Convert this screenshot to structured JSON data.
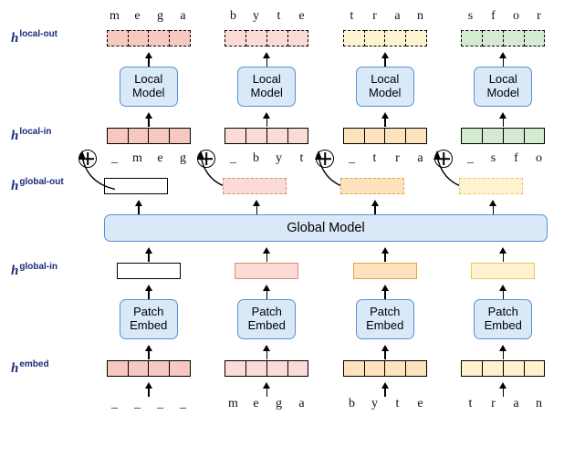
{
  "labels": {
    "local_out": "local-out",
    "local_in": "local-in",
    "global_out": "global-out",
    "global_in": "global-in",
    "embed": "embed",
    "h": "h"
  },
  "components": {
    "local_model": "Local Model",
    "global_model": "Global Model",
    "patch_embed": "Patch Embed"
  },
  "columns": [
    {
      "top_chars": [
        "m",
        "e",
        "g",
        "a"
      ],
      "mid_chars": [
        "_",
        "m",
        "e",
        "g"
      ],
      "bottom_chars": [
        "_",
        "_",
        "_",
        "_"
      ],
      "color_out_dashed": "red",
      "color_local_in": "red",
      "color_global_out": "red-s",
      "global_out_dashed": false,
      "color_global_in": "red-s",
      "color_embed": "red"
    },
    {
      "top_chars": [
        "b",
        "y",
        "t",
        "e"
      ],
      "mid_chars": [
        "_",
        "b",
        "y",
        "t"
      ],
      "bottom_chars": [
        "m",
        "e",
        "g",
        "a"
      ],
      "color_out_dashed": "pink",
      "color_local_in": "pink",
      "color_global_out": "pink-s",
      "global_out_dashed": true,
      "color_global_in": "pink-s",
      "color_embed": "pink"
    },
    {
      "top_chars": [
        "t",
        "r",
        "a",
        "n"
      ],
      "mid_chars": [
        "_",
        "t",
        "r",
        "a"
      ],
      "bottom_chars": [
        "b",
        "y",
        "t",
        "e"
      ],
      "color_out_dashed": "yellow",
      "color_local_in": "orange",
      "color_global_out": "orange-s",
      "global_out_dashed": true,
      "color_global_in": "orange-s",
      "color_embed": "orange"
    },
    {
      "top_chars": [
        "s",
        "f",
        "o",
        "r"
      ],
      "mid_chars": [
        "_",
        "s",
        "f",
        "o"
      ],
      "bottom_chars": [
        "t",
        "r",
        "a",
        "n"
      ],
      "color_out_dashed": "green",
      "color_local_in": "green",
      "color_global_out": "yellow-s",
      "global_out_dashed": true,
      "color_global_in": "yellow-s",
      "color_embed": "yellow"
    }
  ]
}
